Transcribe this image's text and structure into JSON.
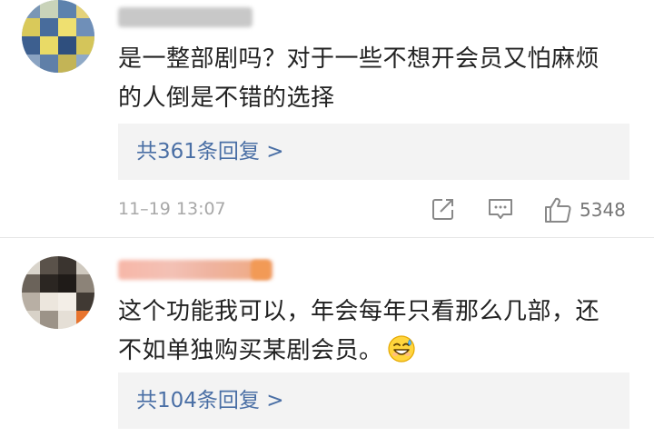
{
  "comments": [
    {
      "content_line1": "是一整部剧吗？对于一些不想开会员又怕麻烦",
      "content_line2": "的人倒是不错的选择",
      "replies_label": "共361条回复 >",
      "timestamp": "11–19 13:07",
      "like_count": "5348",
      "avatar_icon": "pixelated-avatar-icon"
    },
    {
      "content_line1": "这个功能我可以，年会每年只看那么几部，还",
      "content_line2": "不如单独购买某剧会员。",
      "emoji_icon": "grin-sweat-emoji-icon",
      "replies_label": "共104条回复 >",
      "avatar_icon": "pixelated-avatar-icon"
    }
  ],
  "colors": {
    "link_blue": "#4a6fa5",
    "meta_gray": "#a8a8a8",
    "reply_bg": "#f3f3f3",
    "text": "#222222"
  },
  "icons": {
    "share": "share-icon",
    "comment": "comment-icon",
    "like": "thumbs-up-icon"
  }
}
